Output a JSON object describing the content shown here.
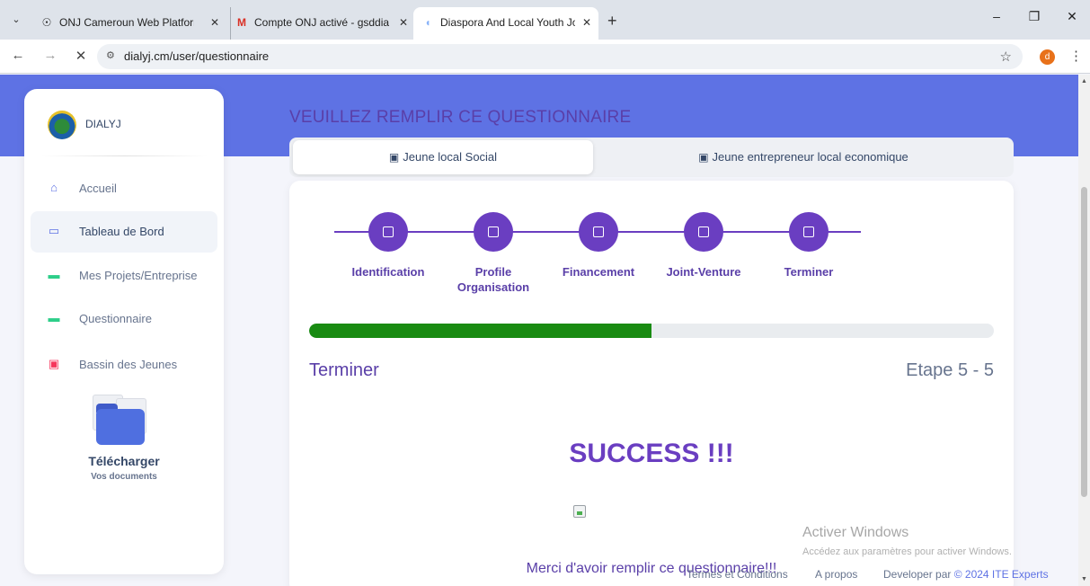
{
  "browser": {
    "tabs": [
      {
        "title": "ONJ Cameroun Web Platform",
        "icon": "globe-icon"
      },
      {
        "title": "Compte ONJ activé - gsddialyj@",
        "icon": "gmail-icon"
      },
      {
        "title": "Diaspora And Local Youth Joint",
        "icon": "loading-icon"
      }
    ],
    "url": "dialyj.cm/user/questionnaire",
    "profile_initial": "d"
  },
  "sidebar": {
    "brand": "DIALYJ",
    "items": [
      {
        "label": "Accueil",
        "icon": "home-icon",
        "color": "#5e72e4"
      },
      {
        "label": "Tableau de Bord",
        "icon": "monitor-icon",
        "color": "#5e72e4"
      },
      {
        "label": "Mes Projets/Entreprise",
        "icon": "card-icon",
        "color": "#2dce89"
      },
      {
        "label": "Questionnaire",
        "icon": "card-icon",
        "color": "#2dce89"
      },
      {
        "label": "Bassin des Jeunes",
        "icon": "id-badge-icon",
        "color": "#f5365c"
      }
    ],
    "download": {
      "title": "Télécharger",
      "subtitle": "Vos documents"
    }
  },
  "main": {
    "title": "VEUILLEZ REMPLIR CE QUESTIONNAIRE",
    "tabs": [
      {
        "label": "Jeune local Social",
        "active": true
      },
      {
        "label": "Jeune entrepreneur local economique",
        "active": false
      }
    ],
    "steps": [
      {
        "label": "Identification"
      },
      {
        "label": "Profile Organisation"
      },
      {
        "label": "Financement"
      },
      {
        "label": "Joint-Venture"
      },
      {
        "label": "Terminer"
      }
    ],
    "progress": 0.5,
    "section_title": "Terminer",
    "step_count": "Etape 5 - 5",
    "success": "SUCCESS !!!",
    "thanks": "Merci d'avoir remplir ce questionnaire!!!"
  },
  "footer": {
    "terms": "Termes et Conditions",
    "about": "A propos",
    "developer": "Developer par",
    "brand": "© 2024 ITE Experts"
  },
  "watermark": {
    "title": "Activer Windows",
    "subtitle": "Accédez aux paramètres pour activer Windows."
  },
  "colors": {
    "accent": "#5e72e4",
    "primary_purple": "#6a3ec1",
    "progress_green": "#198b12"
  }
}
